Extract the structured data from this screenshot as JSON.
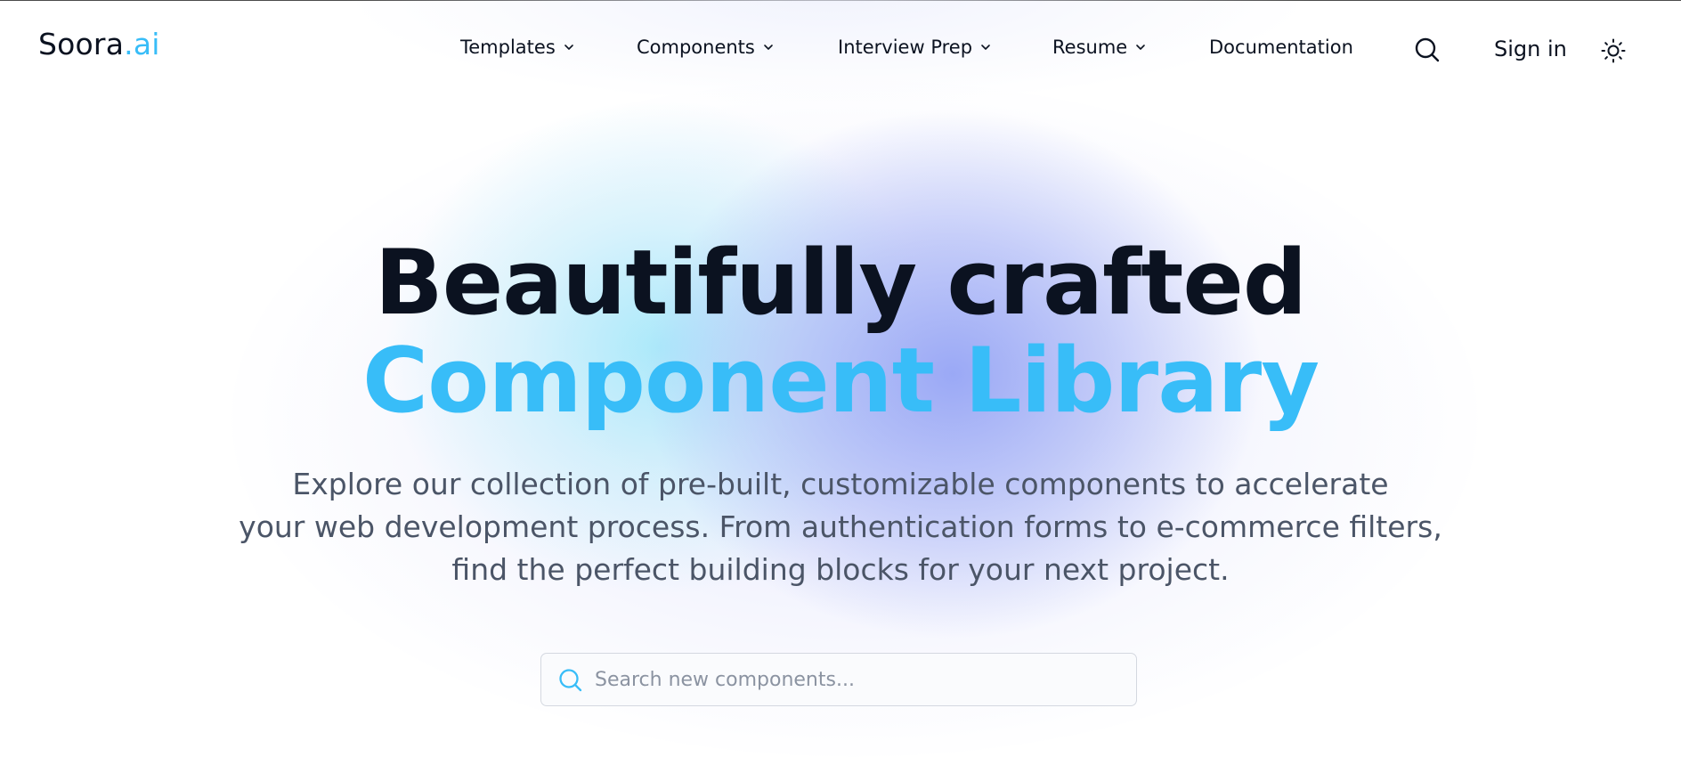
{
  "brand": {
    "name": "Soora",
    "suffix": ".ai"
  },
  "nav": {
    "items": [
      {
        "label": "Templates"
      },
      {
        "label": "Components"
      },
      {
        "label": "Interview Prep"
      },
      {
        "label": "Resume"
      },
      {
        "label": "Documentation"
      }
    ],
    "sign_in_label": "Sign in",
    "search_icon": "search-icon",
    "theme_icon": "sun-icon",
    "dropdown_icon": "chevron-down-icon"
  },
  "hero": {
    "title_part1": "Beautifully crafted ",
    "title_part2": "Component Library",
    "subtitle_line1": "Explore our collection of pre-built, customizable components to accelerate",
    "subtitle_line2": "your web development process. From authentication forms to e-commerce filters,",
    "subtitle_line3": "find the perfect building blocks for your next project."
  },
  "search": {
    "placeholder": "Search new components...",
    "value": ""
  },
  "colors": {
    "accent": "#38bdf8",
    "text": "#0b1220",
    "muted": "#4b5567"
  }
}
